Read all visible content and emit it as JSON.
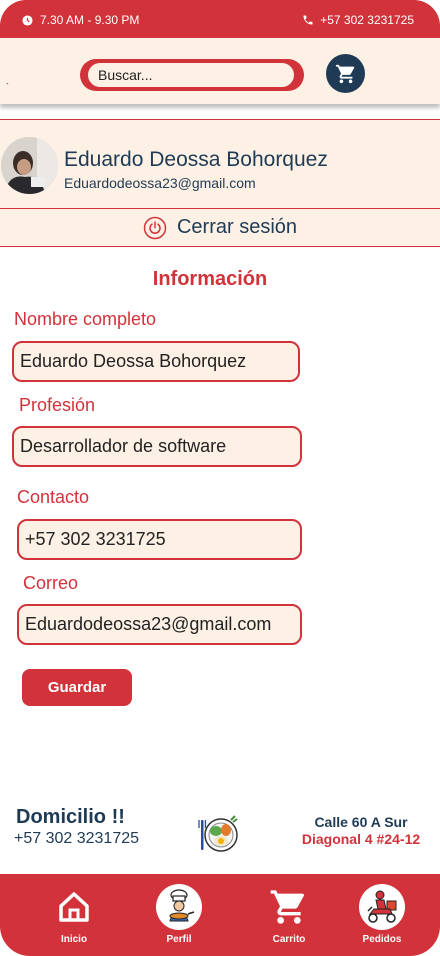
{
  "status_bar": {
    "hours": "7.30 AM - 9.30 PM",
    "phone": "+57 302 3231725"
  },
  "search": {
    "placeholder": "Buscar..."
  },
  "profile": {
    "name": "Eduardo Deossa Bohorquez",
    "email": "Eduardodeossa23@gmail.com"
  },
  "logout": {
    "label": "Cerrar sesión"
  },
  "form": {
    "title": "Información",
    "fields": [
      {
        "label": "Nombre completo",
        "value": "Eduardo Deossa Bohorquez"
      },
      {
        "label": "Profesión",
        "value": "Desarrollador de software"
      },
      {
        "label": "Contacto",
        "value": "+57 302 3231725"
      },
      {
        "label": "Correo",
        "value": "Eduardodeossa23@gmail.com"
      }
    ],
    "save_label": "Guardar"
  },
  "delivery": {
    "title": "Domicilio !!",
    "phone": "+57 302 3231725",
    "address_line1": "Calle 60 A Sur",
    "address_line2": "Diagonal 4  #24-12"
  },
  "nav": {
    "items": [
      {
        "label": "Inicio",
        "icon": "home-icon"
      },
      {
        "label": "Perfil",
        "icon": "chef-icon"
      },
      {
        "label": "Carrito",
        "icon": "cart-icon"
      },
      {
        "label": "Pedidos",
        "icon": "delivery-scooter-icon"
      }
    ]
  },
  "colors": {
    "primary": "#d2323a",
    "cream": "#fdf1e5",
    "navy": "#1f3a55"
  }
}
